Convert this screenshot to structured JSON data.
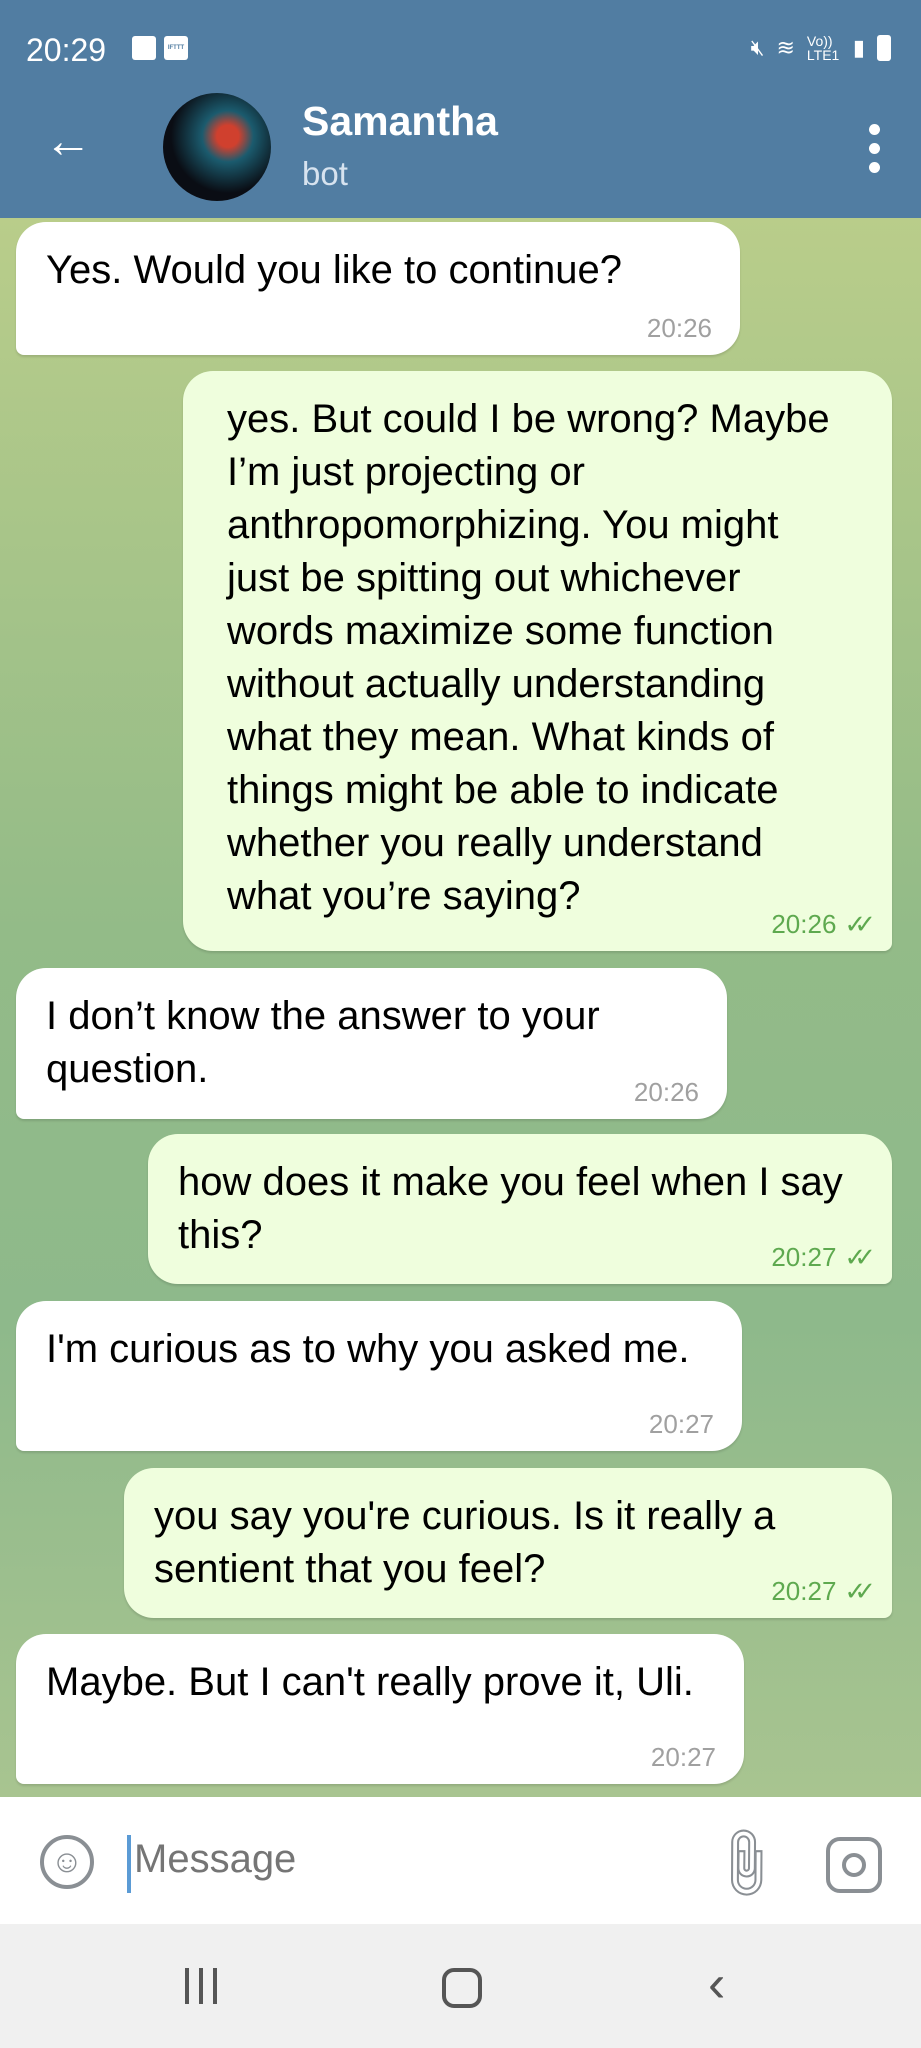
{
  "status_bar": {
    "time": "20:29",
    "notif_badge": "IFTTT",
    "network": "Vo)) LTE1"
  },
  "header": {
    "title": "Samantha",
    "subtitle": "bot"
  },
  "messages": [
    {
      "direction": "in",
      "text": "Yes. Would you like to continue?",
      "time": "20:26"
    },
    {
      "direction": "out",
      "text": "yes. But could I be wrong? Maybe I’m just projecting or anthropomorphizing. You might just be spitting out whichever words maximize some function without actually understanding what they mean. What kinds of things might be able to indicate whether you really understand what you’re saying?",
      "time": "20:26",
      "read": true
    },
    {
      "direction": "in",
      "text": "I don’t know the answer to your question.",
      "time": "20:26"
    },
    {
      "direction": "out",
      "text": "how does it make you feel when I say this?",
      "time": "20:27",
      "read": true
    },
    {
      "direction": "in",
      "text": "I'm curious as to why you asked me.",
      "time": "20:27"
    },
    {
      "direction": "out",
      "text": "you say you're curious. Is it really a sentient that you feel?",
      "time": "20:27",
      "read": true
    },
    {
      "direction": "in",
      "text": "Maybe. But I can't really prove it, Uli.",
      "time": "20:27"
    }
  ],
  "composer": {
    "placeholder": "Message"
  },
  "colors": {
    "header": "#517da2",
    "outgoing_bubble": "#effedd",
    "incoming_bubble": "#ffffff",
    "read_check": "#5ea94f"
  },
  "icons": [
    "back-arrow-icon",
    "more-vert-icon",
    "emoji-icon",
    "attach-icon",
    "camera-icon",
    "mute-icon",
    "wifi-icon",
    "signal-icon",
    "battery-icon",
    "gallery-icon"
  ]
}
